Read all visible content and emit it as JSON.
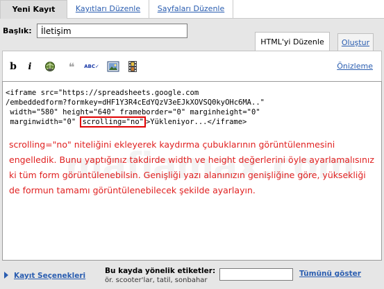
{
  "top_tabs": {
    "new_post": "Yeni Kayıt",
    "edit_posts": "Kayıtları Düzenle",
    "edit_pages": "Sayfaları Düzenle"
  },
  "title": {
    "label": "Başlık:",
    "value": "İletişim"
  },
  "editor_tabs": {
    "html": "HTML'yi Düzenle",
    "compose": "Oluştur"
  },
  "toolbar": {
    "bold": "b",
    "italic": "i",
    "quote": "❝",
    "spell": "ABC✓",
    "preview": "Önizleme"
  },
  "editor": {
    "code_line1": "<iframe src=\"https://spreadsheets.google.com",
    "code_line2": "/embeddedform?formkey=dHF1Y3R4cEdYQzV3eEJkXOVSQ0kyOHc6MA..\"",
    "code_line3": " width=\"580\" height=\"640\" frameborder=\"0\" marginheight=\"0\"",
    "code_line4a": " marginwidth=\"0\" ",
    "code_line4_highlight": "scrolling=\"no\"",
    "code_line4b": ">Yükleniyor...</iframe>",
    "note": "scrolling=\"no\" niteliğini ekleyerek kaydırma çubuklarının görüntülenmesini engelledik. Bunu yaptığınız takdirde width ve height değerlerini öyle ayarlamalısınız ki tüm form görüntülenebilsin. Genişliği yazı alanınızın genişliğine göre, yüksekliği de formun tamamı görüntülenebilecek şekilde ayarlayın.",
    "watermark": "mafiamax.com"
  },
  "bottom": {
    "post_options": "Kayıt Seçenekleri",
    "labels_title": "Bu kayda yönelik etiketler:",
    "labels_hint": "ör. scooter'lar, tatil, sonbahar",
    "labels_value": "",
    "show_all": "Tümünü göster"
  },
  "colors": {
    "link": "#2a5db0",
    "note_text": "#e02020",
    "highlight_border": "#e00000",
    "panel_bg": "#e6e6e6"
  }
}
